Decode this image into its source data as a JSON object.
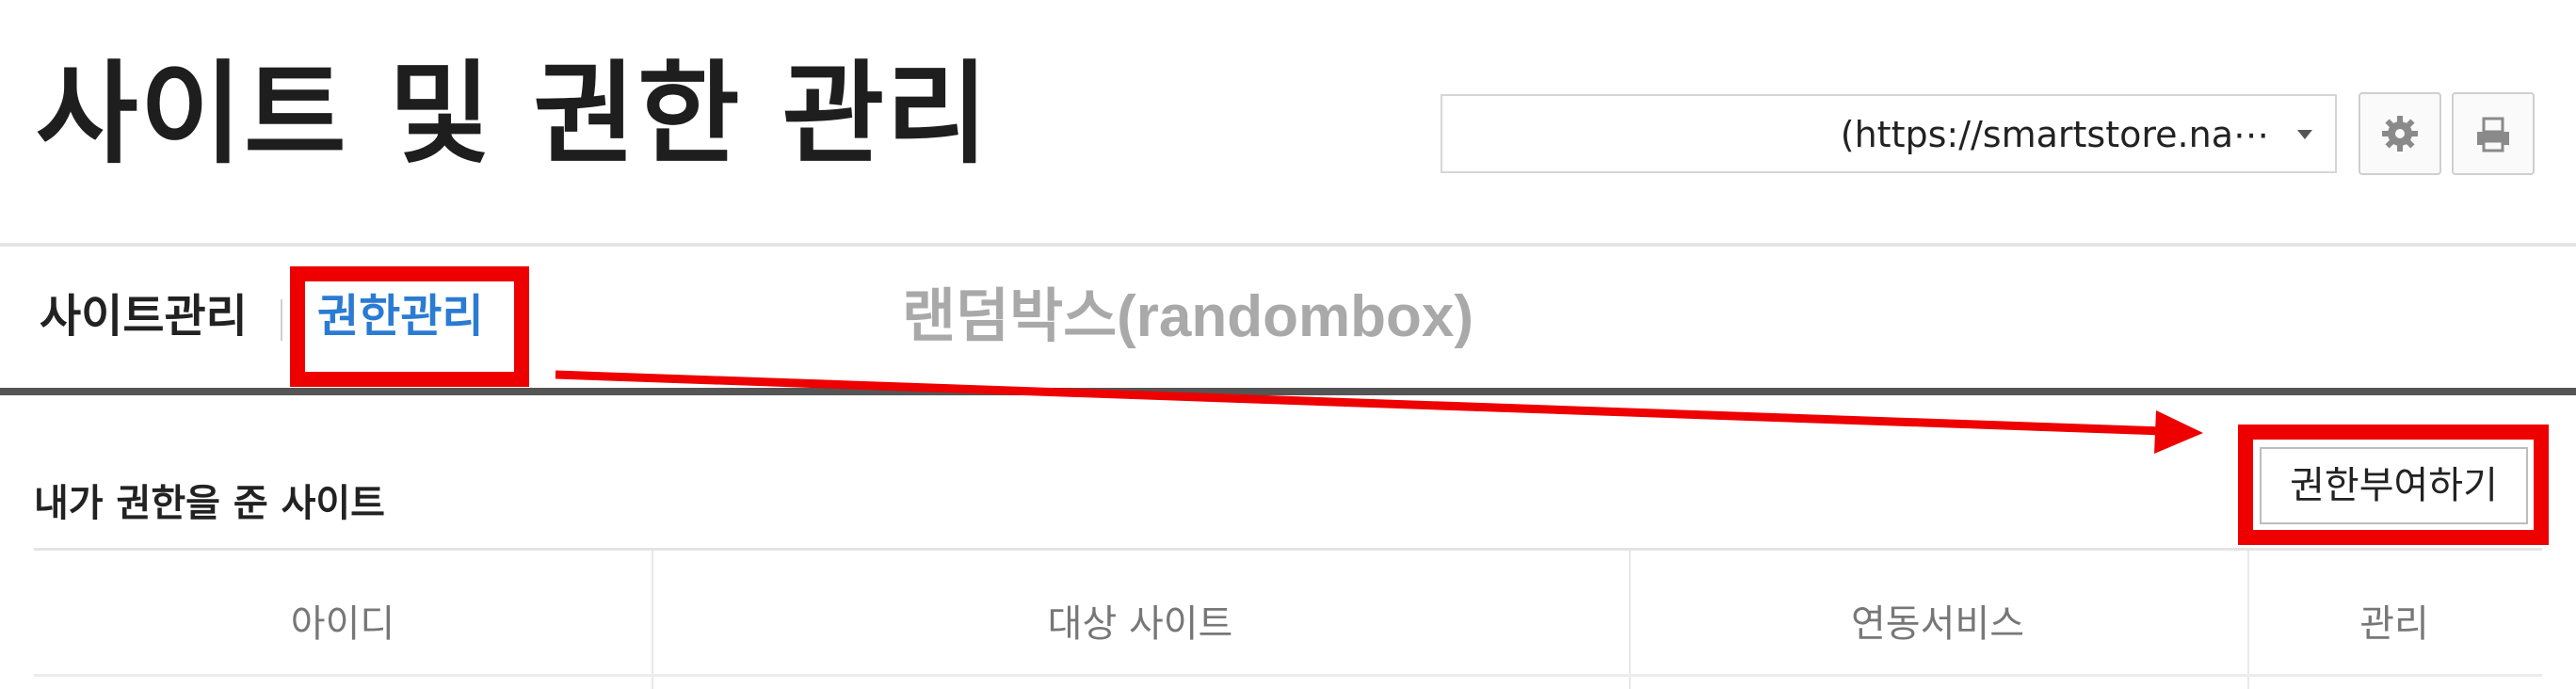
{
  "header": {
    "title": "사이트 및 권한 관리",
    "site_select": {
      "value": "(https://smartstore.na⋯"
    },
    "settings_icon": "gear-icon",
    "print_icon": "printer-icon"
  },
  "tabs": [
    {
      "label": "사이트관리",
      "active": false
    },
    {
      "label": "권한관리",
      "active": true
    }
  ],
  "annotation_text": "랜덤박스(randombox)",
  "section": {
    "title": "내가 권한을 준 사이트",
    "grant_button_label": "권한부여하기"
  },
  "table": {
    "columns": [
      "아이디",
      "대상 사이트",
      "연동서비스",
      "관리"
    ]
  },
  "colors": {
    "accent_blue": "#2a7bd2",
    "highlight_red": "#ee0000",
    "watermark_gray": "#a9a9a9"
  }
}
